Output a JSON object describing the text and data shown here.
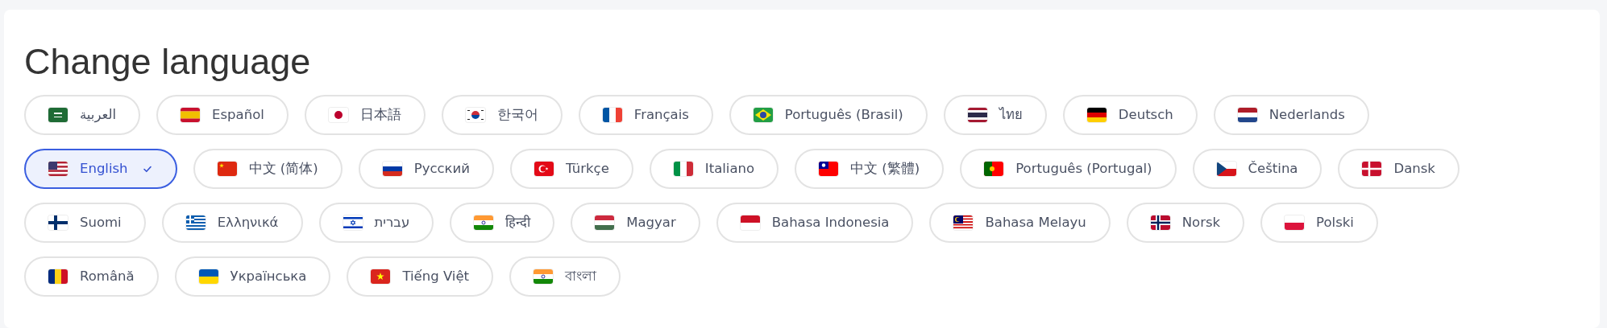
{
  "title": "Change language",
  "languages": [
    {
      "label": "العربية",
      "selected": false
    },
    {
      "label": "Español",
      "selected": false
    },
    {
      "label": "日本語",
      "selected": false
    },
    {
      "label": "한국어",
      "selected": false
    },
    {
      "label": "Français",
      "selected": false
    },
    {
      "label": "Português (Brasil)",
      "selected": false
    },
    {
      "label": "ไทย",
      "selected": false
    },
    {
      "label": "Deutsch",
      "selected": false
    },
    {
      "label": "Nederlands",
      "selected": false
    },
    {
      "label": "English",
      "selected": true
    },
    {
      "label": "中文 (简体)",
      "selected": false
    },
    {
      "label": "Русский",
      "selected": false
    },
    {
      "label": "Türkçe",
      "selected": false
    },
    {
      "label": "Italiano",
      "selected": false
    },
    {
      "label": "中文 (繁體)",
      "selected": false
    },
    {
      "label": "Português (Portugal)",
      "selected": false
    },
    {
      "label": "Čeština",
      "selected": false
    },
    {
      "label": "Dansk",
      "selected": false
    },
    {
      "label": "Suomi",
      "selected": false
    },
    {
      "label": "Ελληνικά",
      "selected": false
    },
    {
      "label": "עברית",
      "selected": false
    },
    {
      "label": "हिन्दी",
      "selected": false
    },
    {
      "label": "Magyar",
      "selected": false
    },
    {
      "label": "Bahasa Indonesia",
      "selected": false
    },
    {
      "label": "Bahasa Melayu",
      "selected": false
    },
    {
      "label": "Norsk",
      "selected": false
    },
    {
      "label": "Polski",
      "selected": false
    },
    {
      "label": "Română",
      "selected": false
    },
    {
      "label": "Українська",
      "selected": false
    },
    {
      "label": "Tiếng Việt",
      "selected": false
    },
    {
      "label": "বাংলা",
      "selected": false
    }
  ]
}
